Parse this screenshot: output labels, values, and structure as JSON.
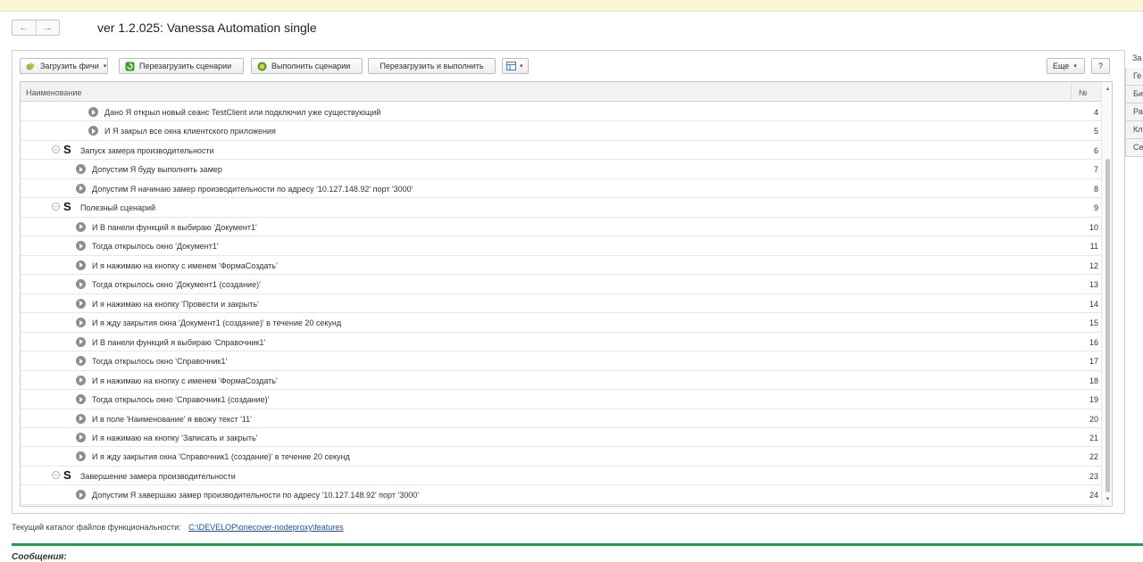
{
  "window": {
    "title": "ver 1.2.025: Vanessa Automation single",
    "back_glyph": "←",
    "forward_glyph": "→"
  },
  "toolbar": {
    "load_features": "Загрузить фичи",
    "reload_scenarios": "Перезагрузить сценарии",
    "run_scenarios": "Выполнить сценарии",
    "reload_and_run": "Перезагрузить и выполнить",
    "more": "Еще",
    "help": "?"
  },
  "grid": {
    "col_name": "Наименование",
    "col_num": "№",
    "rows": [
      {
        "level": "step2",
        "text": "Дано Я открыл новый сеанс TestClient или подключил уже существующий",
        "num": "4"
      },
      {
        "level": "step2",
        "text": "И    Я закрыл все окна клиентского приложения",
        "num": "5"
      },
      {
        "level": "scenario",
        "text": "Запуск замера производительности",
        "num": "6"
      },
      {
        "level": "step",
        "text": "Допустим Я буду выполнять замер",
        "num": "7"
      },
      {
        "level": "step",
        "text": "Допустим Я начинаю замер производительности по адресу '10.127.148.92' порт '3000'",
        "num": "8"
      },
      {
        "level": "scenario",
        "text": "Полезный сценарий",
        "num": "9"
      },
      {
        "level": "step",
        "text": "И В панели функций я выбираю 'Документ1'",
        "num": "10"
      },
      {
        "level": "step",
        "text": "Тогда открылось окно 'Документ1'",
        "num": "11"
      },
      {
        "level": "step",
        "text": "И я нажимаю на кнопку с именем 'ФормаСоздать'",
        "num": "12"
      },
      {
        "level": "step",
        "text": "Тогда открылось окно 'Документ1 (создание)'",
        "num": "13"
      },
      {
        "level": "step",
        "text": "И я нажимаю на кнопку 'Провести и закрыть'",
        "num": "14"
      },
      {
        "level": "step",
        "text": "И я жду закрытия окна 'Документ1 (создание)' в течение 20 секунд",
        "num": "15"
      },
      {
        "level": "step",
        "text": "И В панели функций я выбираю 'Справочник1'",
        "num": "16"
      },
      {
        "level": "step",
        "text": "Тогда открылось окно 'Справочник1'",
        "num": "17"
      },
      {
        "level": "step",
        "text": "И я нажимаю на кнопку с именем 'ФормаСоздать'",
        "num": "18"
      },
      {
        "level": "step",
        "text": "Тогда открылось окно 'Справочник1 (создание)'",
        "num": "19"
      },
      {
        "level": "step",
        "text": "И в поле 'Наименование' я ввожу текст '11'",
        "num": "20"
      },
      {
        "level": "step",
        "text": "И я нажимаю на кнопку 'Записать и закрыть'",
        "num": "21"
      },
      {
        "level": "step",
        "text": "И я жду закрытия окна 'Справочник1 (создание)' в течение 20 секунд",
        "num": "22"
      },
      {
        "level": "scenario",
        "text": "Завершение замера производительности",
        "num": "23"
      },
      {
        "level": "step",
        "text": "Допустим Я завершаю замер производительности по адресу '10.127.148.92' порт '3000'",
        "num": "24"
      }
    ]
  },
  "side_tabs": [
    "За",
    "Ге",
    "Би",
    "Ра",
    "Кл",
    "Се"
  ],
  "footer": {
    "label": "Текущий каталог файлов функциональности:",
    "path": "C:\\DEVELOP\\onecover-nodeproxy\\features",
    "messages_label": "Сообщения:"
  },
  "colors": {
    "accent_green": "#16a34a",
    "link_blue": "#1f4ea3",
    "top_strip": "#fbf6d7"
  }
}
